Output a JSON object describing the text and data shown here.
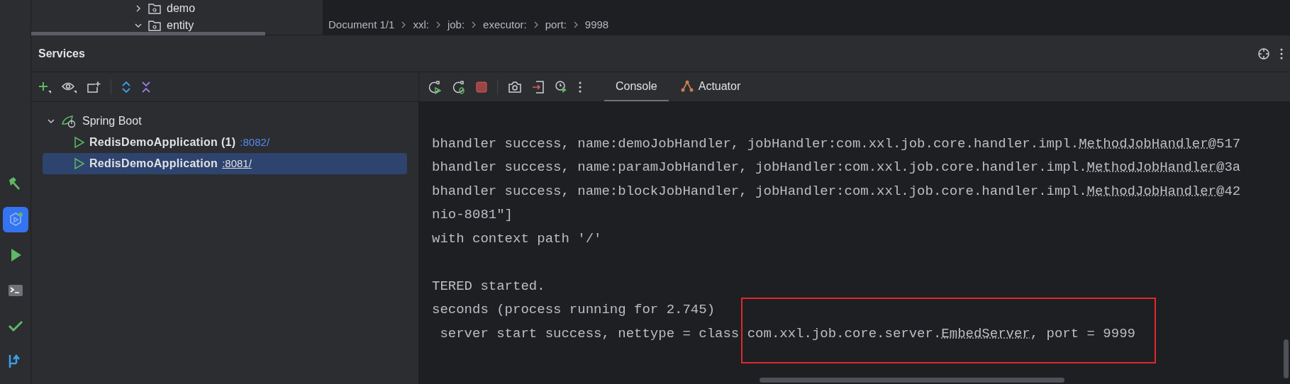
{
  "project_tree": [
    {
      "label": "demo",
      "expanded": false
    },
    {
      "label": "entity",
      "expanded": true
    }
  ],
  "breadcrumb": [
    "Document 1/1",
    "xxl:",
    "job:",
    "executor:",
    "port:",
    "9998"
  ],
  "tool_rail": [
    {
      "kind": "build",
      "selected": false
    },
    {
      "kind": "services",
      "selected": true
    },
    {
      "kind": "run",
      "selected": false
    },
    {
      "kind": "terminal",
      "selected": false
    },
    {
      "kind": "problems",
      "selected": false
    },
    {
      "kind": "vcs",
      "selected": false
    }
  ],
  "services": {
    "title": "Services",
    "tree": [
      {
        "label": "Spring Boot",
        "expanded": true,
        "children": [
          {
            "label": "RedisDemoApplication (1)",
            "port": ":8082/",
            "selected": false
          },
          {
            "label": "RedisDemoApplication",
            "port": ":8081/",
            "selected": true
          }
        ]
      }
    ],
    "tabs": [
      {
        "label": "Console",
        "selected": true
      },
      {
        "label": "Actuator",
        "selected": false
      }
    ],
    "console": [
      {
        "before": "bhandler success, name:demoJobHandler, jobHandler:com.xxl.job.core.handler.impl.",
        "link": "MethodJobHandler",
        "after": "@517"
      },
      {
        "before": "bhandler success, name:paramJobHandler, jobHandler:com.xxl.job.core.handler.impl.",
        "link": "MethodJobHandler",
        "after": "@3a"
      },
      {
        "before": "bhandler success, name:blockJobHandler, jobHandler:com.xxl.job.core.handler.impl.",
        "link": "MethodJobHandler",
        "after": "@42"
      },
      {
        "before": "nio-8081\"]"
      },
      {
        "before": "with context path '/'"
      },
      {
        "blank": true
      },
      {
        "before": "TERED started."
      },
      {
        "before": "seconds (process running for 2.745)"
      },
      {
        "before": " server start success, nettype = class com.xxl.job.core.server.",
        "link": "EmbedServer",
        "after": ", port = 9999",
        "highlighted": true
      }
    ]
  }
}
